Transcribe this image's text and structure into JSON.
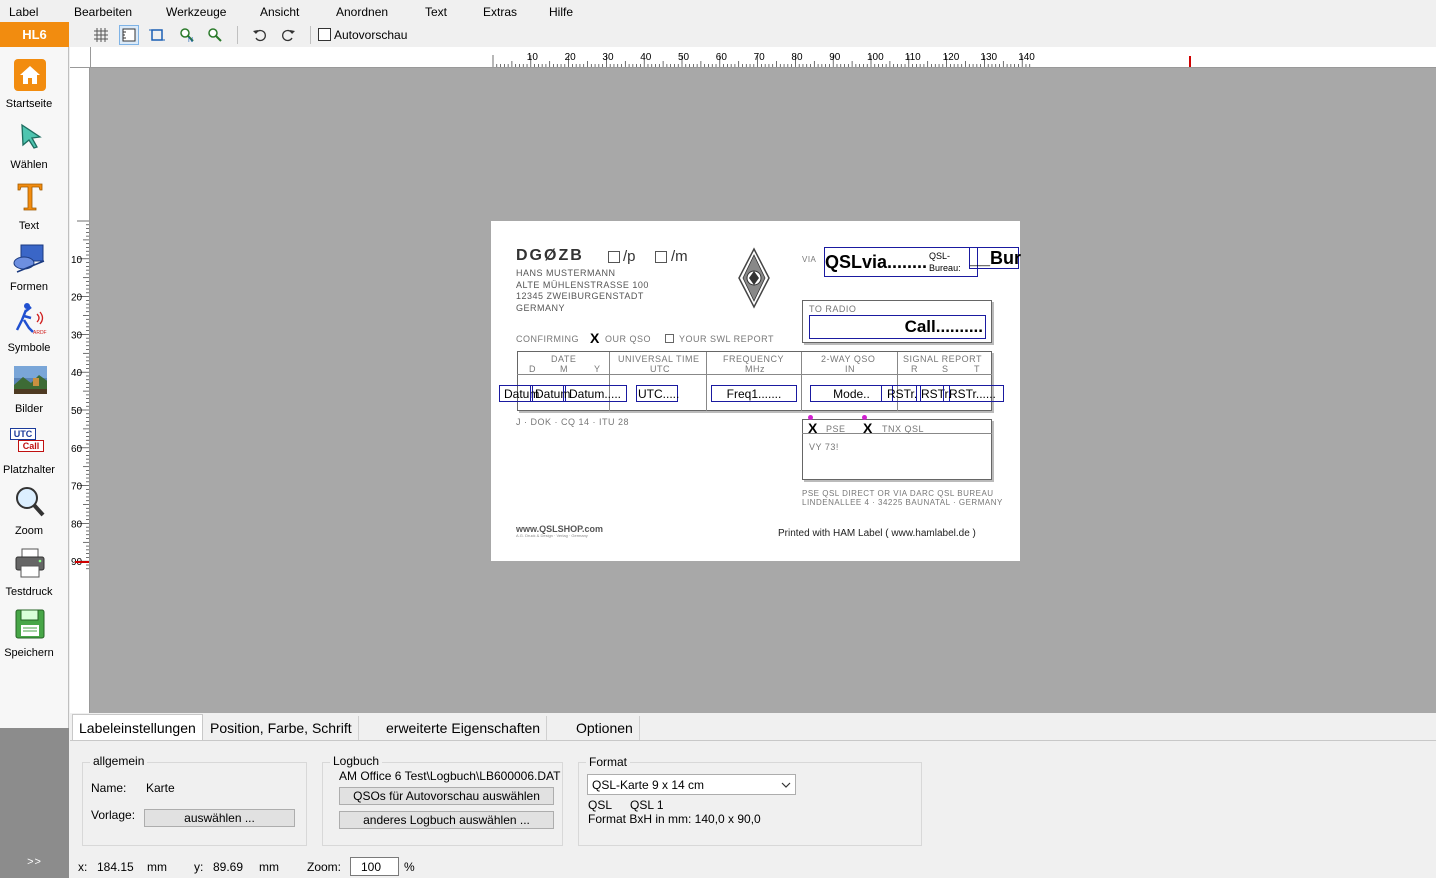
{
  "menu": [
    "Label",
    "Bearbeiten",
    "Werkzeuge",
    "Ansicht",
    "Anordnen",
    "Text",
    "Extras",
    "Hilfe"
  ],
  "badge": "HL6",
  "toolbar": {
    "autopreview_label": "Autovorschau"
  },
  "sidebar": {
    "items": [
      {
        "label": "Startseite",
        "icon": "home-icon"
      },
      {
        "label": "Wählen",
        "icon": "select-arrow-icon"
      },
      {
        "label": "Text",
        "icon": "text-icon"
      },
      {
        "label": "Formen",
        "icon": "shapes-icon"
      },
      {
        "label": "Symbole",
        "icon": "symbols-icon"
      },
      {
        "label": "Bilder",
        "icon": "images-icon"
      },
      {
        "label": "Platzhalter",
        "icon": "placeholder-icon"
      },
      {
        "label": "Zoom",
        "icon": "zoom-icon"
      },
      {
        "label": "Testdruck",
        "icon": "printer-icon"
      },
      {
        "label": "Speichern",
        "icon": "save-icon"
      }
    ],
    "placeholder_utc": "UTC",
    "placeholder_call": "Call",
    "expand": ">>"
  },
  "ruler": {
    "h_labels": [
      "10",
      "20",
      "30",
      "40",
      "50",
      "60",
      "70",
      "80",
      "90",
      "100",
      "110",
      "120",
      "130",
      "140"
    ],
    "v_labels": [
      "10",
      "20",
      "30",
      "40",
      "50",
      "60",
      "70",
      "80",
      "90"
    ]
  },
  "card": {
    "callsign": "DGØZB",
    "p_suffix": "/p",
    "m_suffix": "/m",
    "address": [
      "HANS MUSTERMANN",
      "ALTE MÜHLENSTRASSE 100",
      "12345 ZWEIBURGENSTADT",
      "GERMANY"
    ],
    "via": "VIA",
    "qsl_via": "QSLvia........",
    "qsl_bureau": "QSL-Bureau:",
    "bur": "__Bur",
    "to_radio": "TO RADIO",
    "call": "Call..........",
    "confirming": "CONFIRMING",
    "our_qso": "OUR QSO",
    "your_swl": "YOUR SWL REPORT",
    "x_mark": "X",
    "headers": {
      "date": "DATE",
      "date_sub": [
        "D",
        "M",
        "Y"
      ],
      "utc": "UNIVERSAL TIME",
      "utc_sub": "UTC",
      "freq": "FREQUENCY",
      "freq_sub": "MHz",
      "qso": "2-WAY QSO",
      "qso_sub": "IN",
      "signal": "SIGNAL REPORT",
      "signal_sub": [
        "R",
        "S",
        "T"
      ]
    },
    "fields": {
      "datum1": "Datum",
      "datum2": "Datum",
      "datum3": "Datum.....",
      "utc": "UTC.....",
      "freq": "Freq1.......",
      "mode": "Mode..",
      "rst1": "RSTr.",
      "rst2": "RSTr.",
      "rst3": "RSTr......"
    },
    "footer_line": "J   ·   DOK   ·   CQ 14   ·   ITU 28",
    "pse": "PSE",
    "tnx": "TNX QSL",
    "vy73": "VY 73!",
    "bureau_line1": "PSE QSL DIRECT OR VIA DARC QSL BUREAU",
    "bureau_line2": "LINDENALLEE 4 · 34225 BAUNATAL · GERMANY",
    "shop_logo": "www.QSLSHOP.com",
    "shop_small": "A.G. Druck & Design · Verlag · Germany",
    "printed_with": "Printed with HAM Label ( www.hamlabel.de )"
  },
  "tabs": [
    "Labeleinstellungen",
    "Position, Farbe, Schrift",
    "erweiterte Eigenschaften",
    "Optionen"
  ],
  "settings": {
    "general": {
      "title": "allgemein",
      "name_label": "Name:",
      "name_value": "Karte",
      "template_label": "Vorlage:",
      "choose_btn": "auswählen ..."
    },
    "logbook": {
      "title": "Logbuch",
      "path": "AM Office 6 Test\\Logbuch\\LB600006.DAT",
      "btn_qsos": "QSOs für Autovorschau auswählen",
      "btn_other": "anderes Logbuch auswählen ..."
    },
    "format": {
      "title": "Format",
      "selected": "QSL-Karte 9 x 14 cm",
      "type_a": "QSL",
      "type_b": "QSL 1",
      "dims": "Format BxH in mm: 140,0 x 90,0"
    }
  },
  "status": {
    "x_label": "x:",
    "x_value": "184.15",
    "y_label": "y:",
    "y_value": "89.69",
    "unit": "mm",
    "zoom_label": "Zoom:",
    "zoom_value": "100",
    "percent": "%"
  },
  "colors": {
    "accent": "#f28c0f",
    "field_border": "#1a1aa0",
    "canvas": "#a8a8a8",
    "ruler_marker": "#d00000"
  }
}
